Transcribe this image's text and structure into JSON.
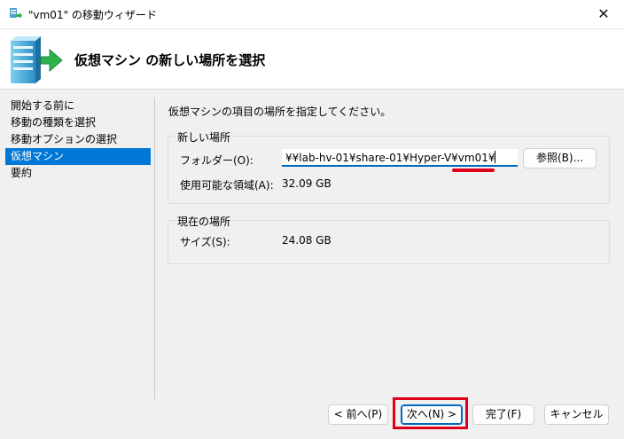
{
  "window": {
    "title": "\"vm01\" の移動ウィザード",
    "close_glyph": "✕"
  },
  "header": {
    "heading": "仮想マシン の新しい場所を選択"
  },
  "nav": {
    "items": [
      {
        "label": "開始する前に",
        "active": false
      },
      {
        "label": "移動の種類を選択",
        "active": false
      },
      {
        "label": "移動オプションの選択",
        "active": false
      },
      {
        "label": "仮想マシン",
        "active": true
      },
      {
        "label": "要約",
        "active": false
      }
    ]
  },
  "main": {
    "instruction": "仮想マシンの項目の場所を指定してください。",
    "new_location": {
      "group_title": "新しい場所",
      "folder_label": "フォルダー(O):",
      "folder_value": "¥¥lab-hv-01¥share-01¥Hyper-V¥vm01¥",
      "browse_label": "参照(B)...",
      "space_label": "使用可能な領域(A):",
      "space_value": "32.09 GB"
    },
    "current_location": {
      "group_title": "現在の場所",
      "size_label": "サイズ(S):",
      "size_value": "24.08 GB"
    }
  },
  "footer": {
    "back_label": "< 前へ(P)",
    "next_label": "次へ(N) >",
    "finish_label": "完了(F)",
    "cancel_label": "キャンセル"
  },
  "colors": {
    "accent": "#0078d7",
    "highlight_red": "#e0001b"
  }
}
